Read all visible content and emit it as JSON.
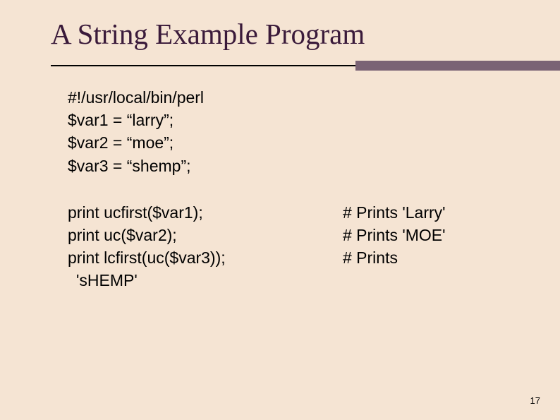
{
  "title": "A String Example Program",
  "code_block1": {
    "line1": "#!/usr/local/bin/perl",
    "line2": "$var1 = “larry”;",
    "line3": "$var2 = “moe”;",
    "line4": "$var3 = “shemp”;"
  },
  "code_block2": {
    "row1_left": "print ucfirst($var1);",
    "row1_right": "# Prints 'Larry'",
    "row2_left": "print uc($var2);",
    "row2_right": "# Prints 'MOE'",
    "row3_left": "print lcfirst(uc($var3));",
    "row3_right": "# Prints",
    "row3_wrap": "'sHEMP'"
  },
  "page_number": "17"
}
